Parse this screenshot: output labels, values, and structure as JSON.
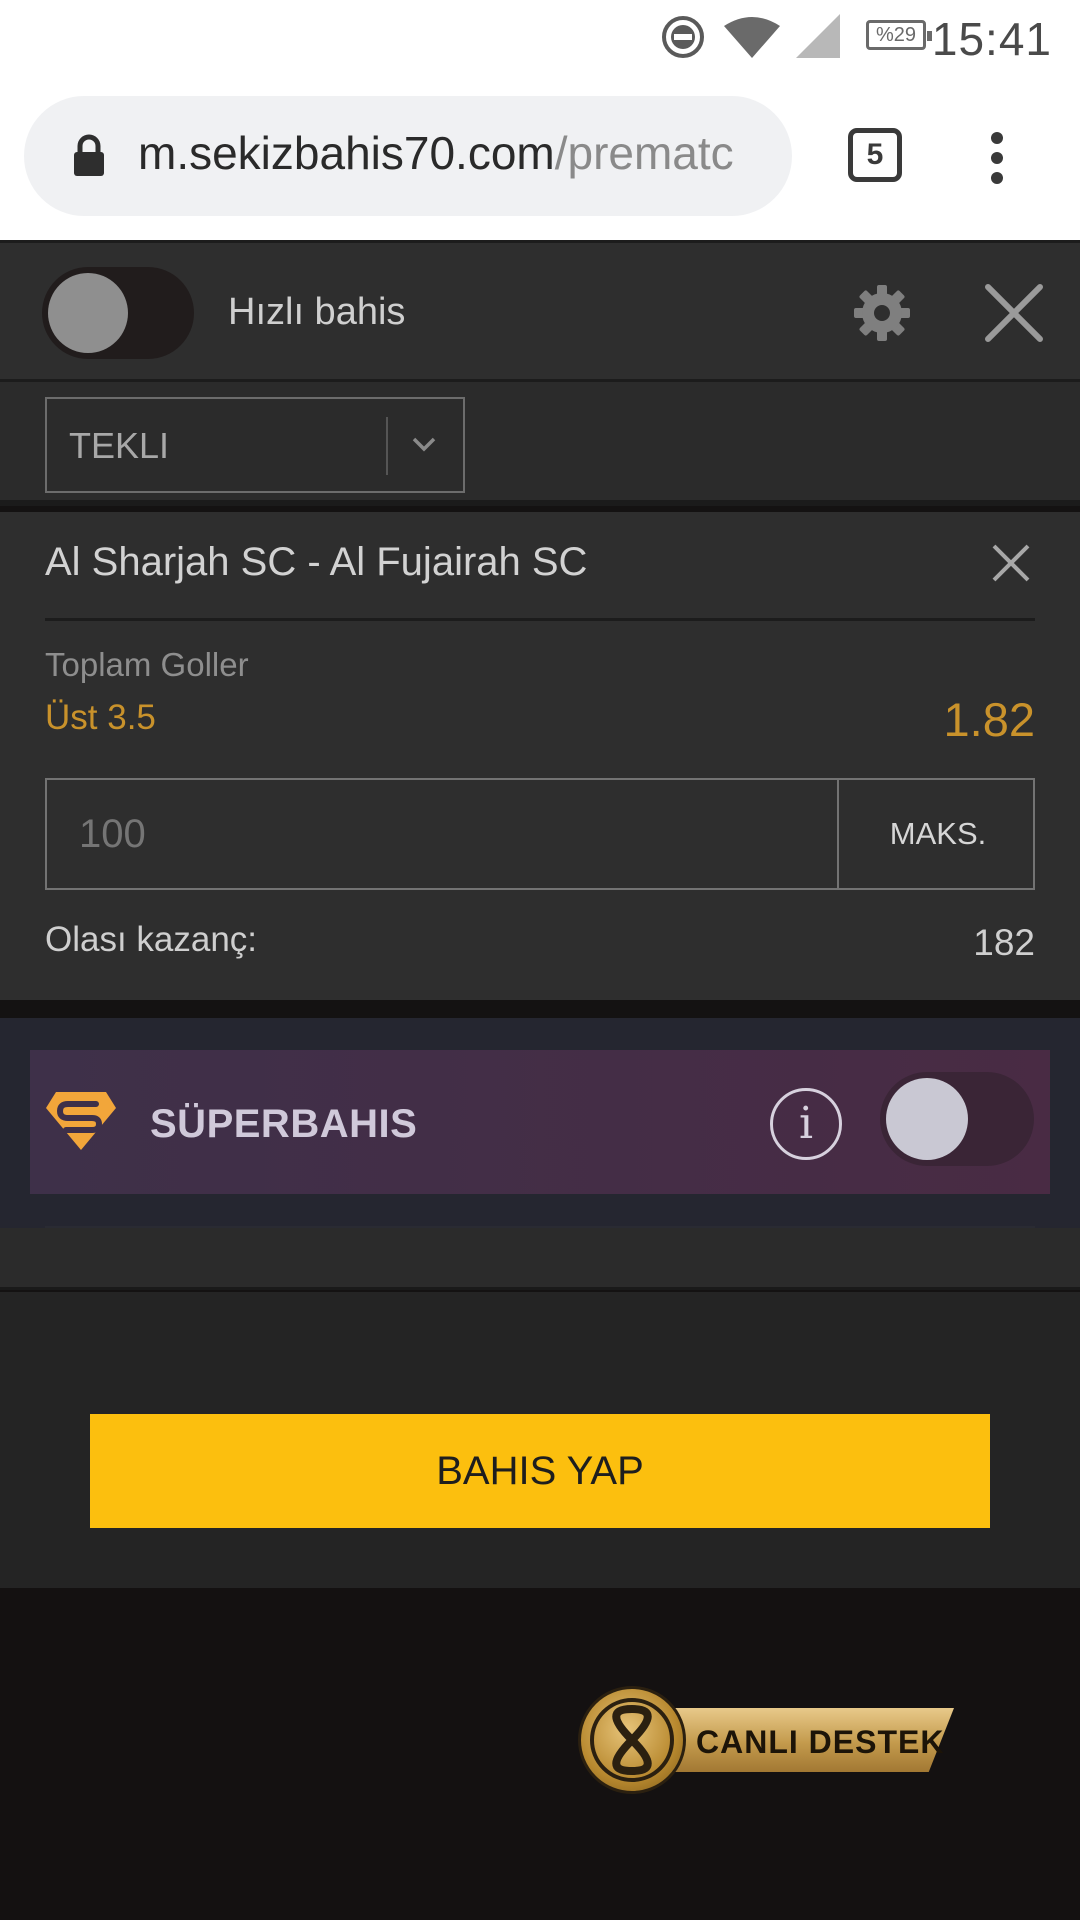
{
  "status_bar": {
    "time": "15:41",
    "battery": "%29",
    "icons": [
      "do-not-disturb-icon",
      "wifi-icon",
      "signal-icon",
      "battery-icon"
    ]
  },
  "browser": {
    "url_host": "m.sekizbahis70.com",
    "url_path": "/prematc",
    "tab_count": "5",
    "icons": [
      "lock-icon",
      "more-vert-icon"
    ]
  },
  "slip_header": {
    "quick_bet_label": "Hızlı bahis",
    "icons": [
      "gear-icon",
      "close-icon"
    ]
  },
  "bet_type": {
    "selected": "TEKLI"
  },
  "bet": {
    "match": "Al Sharjah SC - Al Fujairah SC",
    "market": "Toplam Goller",
    "selection": "Üst 3.5",
    "odds": "1.82",
    "stake_placeholder": "100",
    "max_label": "MAKS.",
    "potential_win_label": "Olası kazanç:",
    "potential_win_value": "182"
  },
  "superbahis": {
    "label": "SÜPERBAHIS",
    "info_glyph": "i"
  },
  "action": {
    "place_bet_label": "BAHIS YAP"
  },
  "support": {
    "label_light": "CANLI ",
    "label_bold": "DESTEK"
  },
  "colors": {
    "accent_yellow": "#fcbf0e",
    "odds_gold": "#c9922b",
    "panel_dark": "#2e2e2e",
    "super_banner": "#452d47"
  }
}
